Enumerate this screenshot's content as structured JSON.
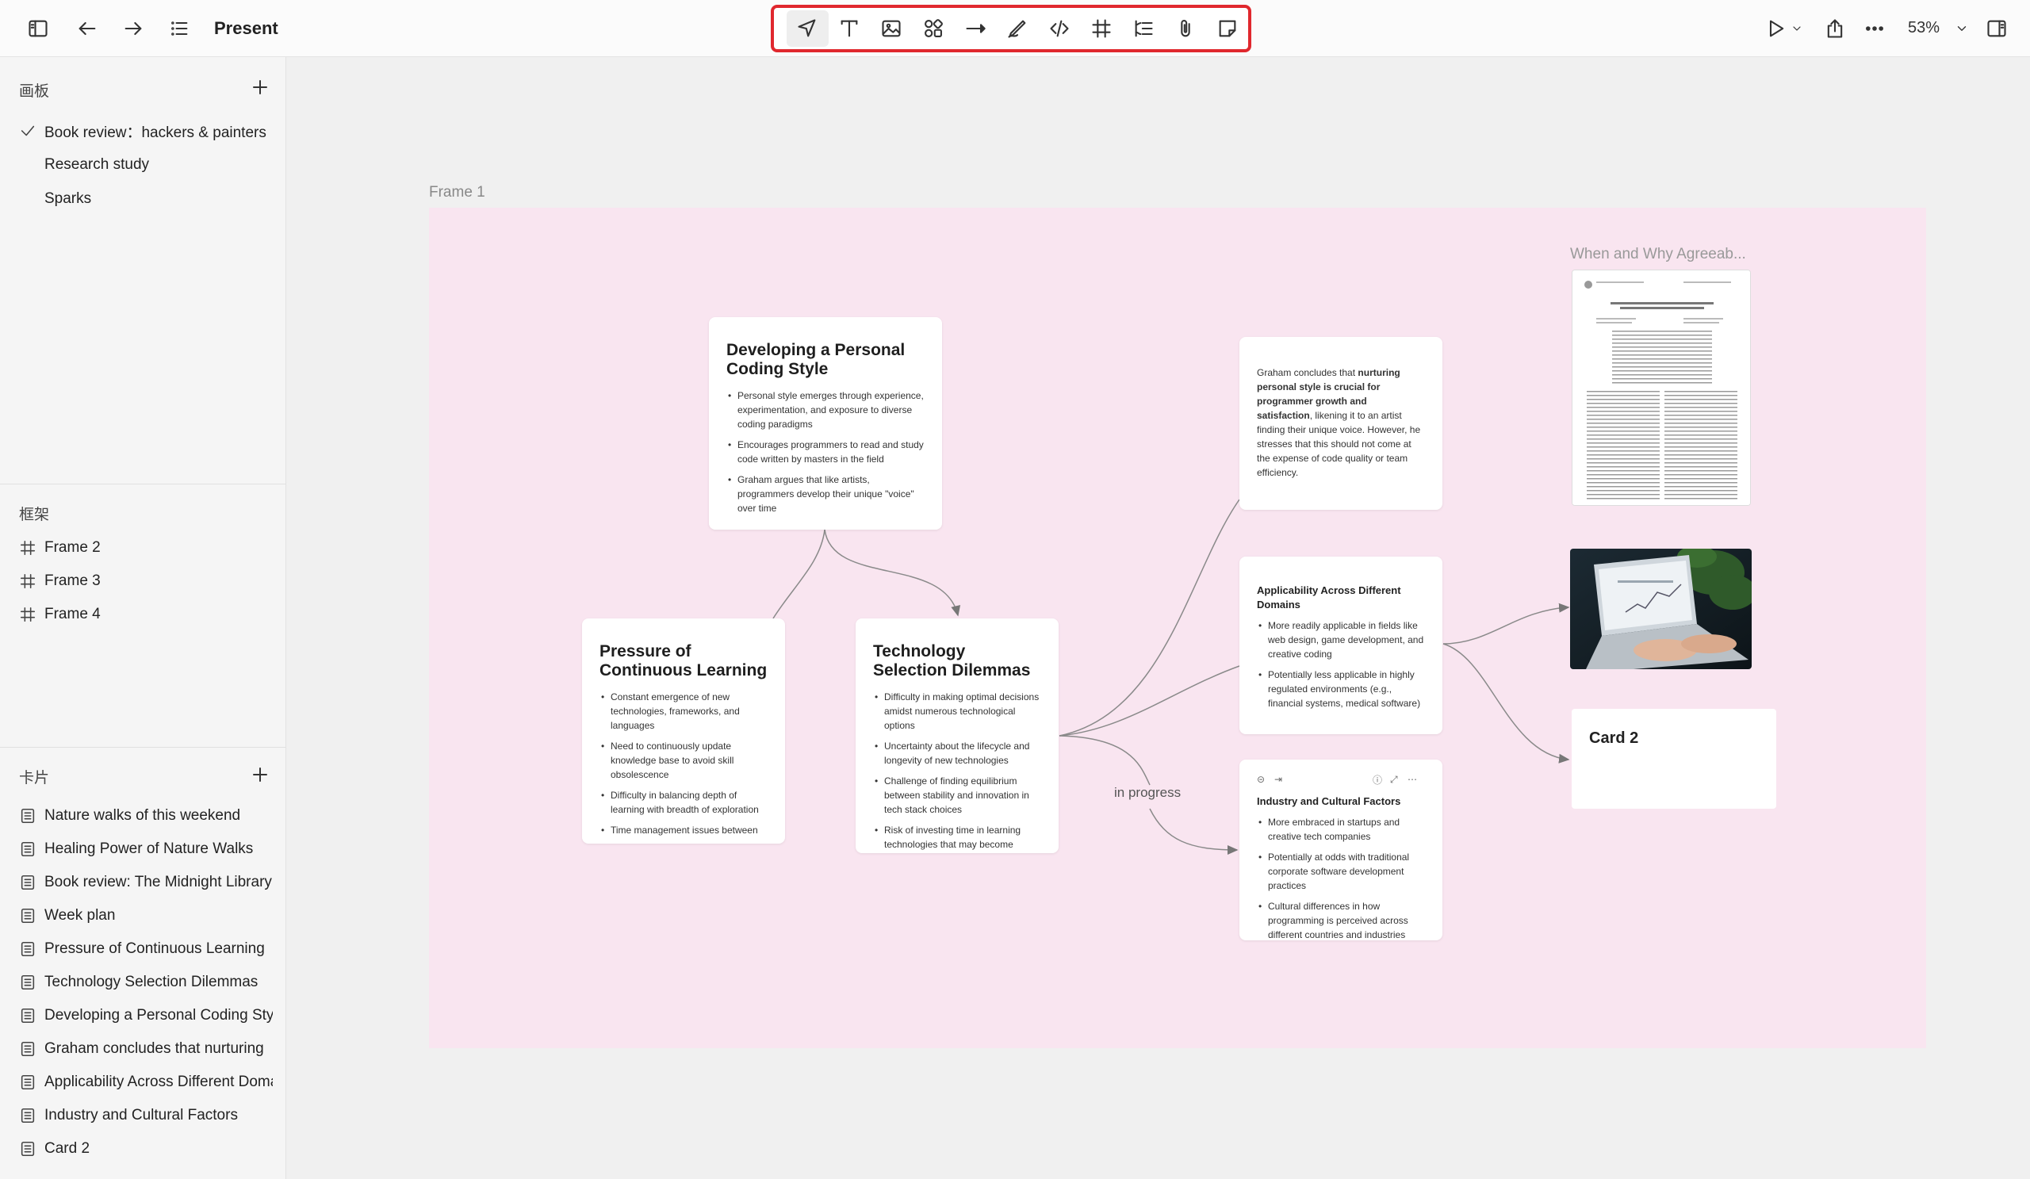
{
  "header": {
    "title": "Present",
    "zoom": "53%"
  },
  "sidebar": {
    "boards": {
      "title": "画板",
      "items": [
        {
          "label": "Book review：hackers & painters",
          "selected": true
        },
        {
          "label": "Research study",
          "selected": false
        },
        {
          "label": "Sparks",
          "selected": false
        }
      ]
    },
    "frames": {
      "title": "框架",
      "items": [
        {
          "label": "Frame 2"
        },
        {
          "label": "Frame 3"
        },
        {
          "label": "Frame 4"
        }
      ]
    },
    "cards": {
      "title": "卡片",
      "items": [
        {
          "label": "Nature walks of this weekend"
        },
        {
          "label": "Healing Power of Nature Walks"
        },
        {
          "label": "Book review: The Midnight Library"
        },
        {
          "label": "Week plan"
        },
        {
          "label": "Pressure of Continuous Learning"
        },
        {
          "label": "Technology Selection Dilemmas"
        },
        {
          "label": "Developing a Personal Coding Style"
        },
        {
          "label": "Graham concludes that nurturing"
        },
        {
          "label": "Applicability Across Different Domains"
        },
        {
          "label": "Industry and Cultural Factors"
        },
        {
          "label": "Card 2"
        }
      ]
    }
  },
  "canvas": {
    "frame_label": "Frame 1",
    "edge_label": "in progress",
    "cards": {
      "coding_style": {
        "title": "Developing a Personal Coding Style",
        "bullets": [
          "Personal style emerges through experience, experimentation, and exposure to diverse coding paradigms",
          "Encourages programmers to read and study code written by masters in the field",
          "Graham argues that like artists, programmers develop their unique \"voice\" over time"
        ]
      },
      "pressure": {
        "title": "Pressure of Continuous Learning",
        "bullets": [
          "Constant emergence of new technologies, frameworks, and languages",
          "Need to continuously update knowledge base to avoid skill obsolescence",
          "Difficulty in balancing depth of learning with breadth of exploration",
          "Time management issues between"
        ]
      },
      "tech_selection": {
        "title": "Technology Selection Dilemmas",
        "bullets": [
          "Difficulty in making optimal decisions amidst numerous technological options",
          "Uncertainty about the lifecycle and longevity of new technologies",
          "Challenge of finding equilibrium between stability and innovation in tech stack choices",
          "Risk of investing time in learning technologies that may become"
        ]
      },
      "graham": {
        "text_pre": "Graham concludes that ",
        "text_bold": "nurturing personal style is crucial for programmer growth and satisfaction",
        "text_post": ", likening it to an artist finding their unique voice. However, he stresses that this should not come at the expense of code quality or team efficiency."
      },
      "applicability": {
        "title": "Applicability Across Different Domains",
        "bullets": [
          "More readily applicable in fields like web design, game development, and creative coding",
          "Potentially less applicable in highly regulated environments (e.g., financial systems, medical software)"
        ]
      },
      "industry": {
        "title": "Industry and Cultural Factors",
        "bullets": [
          "More embraced in startups and creative tech companies",
          "Potentially at odds with traditional corporate software development practices",
          "Cultural differences in how programming is perceived across different countries and industries"
        ]
      },
      "card2": {
        "title": "Card 2"
      }
    },
    "media": {
      "paper_title": "When and Why Agreeab..."
    }
  }
}
